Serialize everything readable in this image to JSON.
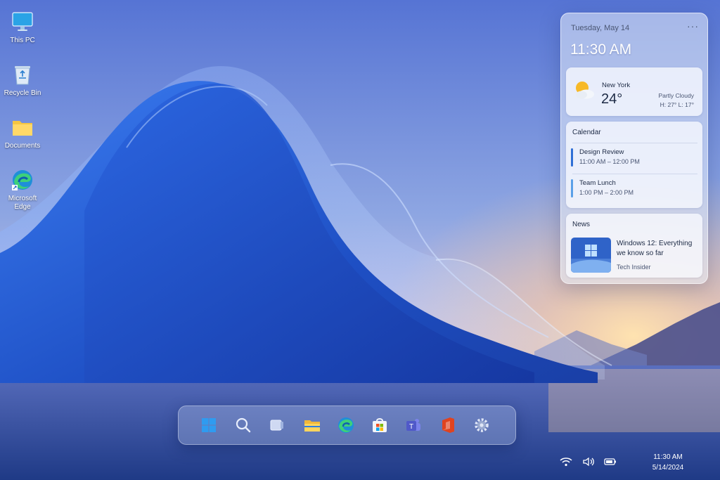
{
  "desktop": {
    "icons": [
      {
        "label": "This PC",
        "icon": "monitor-icon"
      },
      {
        "label": "Recycle Bin",
        "icon": "recycle-bin-icon"
      },
      {
        "label": "Documents",
        "icon": "folder-icon"
      },
      {
        "label": "Microsoft Edge",
        "icon": "edge-icon"
      }
    ]
  },
  "widgets": {
    "date": "Tuesday, May 14",
    "more": "···",
    "time": "11:30 AM",
    "weather": {
      "city": "New York",
      "temp": "24°",
      "condition": "Partly Cloudy",
      "hi_lo": "H: 27° L: 17°",
      "icon": "partly-cloudy-icon"
    },
    "calendar": {
      "title": "Calendar",
      "events": [
        {
          "title": "Design Review",
          "time": "11:00 AM – 12:00 PM",
          "color": "#2f6fd6"
        },
        {
          "title": "Team Lunch",
          "time": "1:00 PM – 2:00 PM",
          "color": "#5aa0e8"
        }
      ]
    },
    "news": {
      "title": "News",
      "headline": "Windows 12: Everything we know so far",
      "source": "Tech Insider"
    }
  },
  "taskbar": {
    "apps": [
      {
        "name": "Start",
        "icon": "windows-start-icon"
      },
      {
        "name": "Search",
        "icon": "search-icon"
      },
      {
        "name": "Task View",
        "icon": "task-view-icon"
      },
      {
        "name": "File Explorer",
        "icon": "file-explorer-icon"
      },
      {
        "name": "Microsoft Edge",
        "icon": "edge-icon"
      },
      {
        "name": "Microsoft Store",
        "icon": "store-icon"
      },
      {
        "name": "Teams",
        "icon": "teams-icon"
      },
      {
        "name": "Office",
        "icon": "office-icon"
      },
      {
        "name": "Settings",
        "icon": "settings-gear-icon"
      }
    ]
  },
  "tray": {
    "icons": [
      "wifi-icon",
      "volume-icon",
      "battery-icon"
    ],
    "time": "11:30 AM",
    "date": "5/14/2024"
  },
  "colors": {
    "accent": "#2f6fd6",
    "wallpaper_blue": "#2d5fd0",
    "sunset": "#f6c89a"
  }
}
